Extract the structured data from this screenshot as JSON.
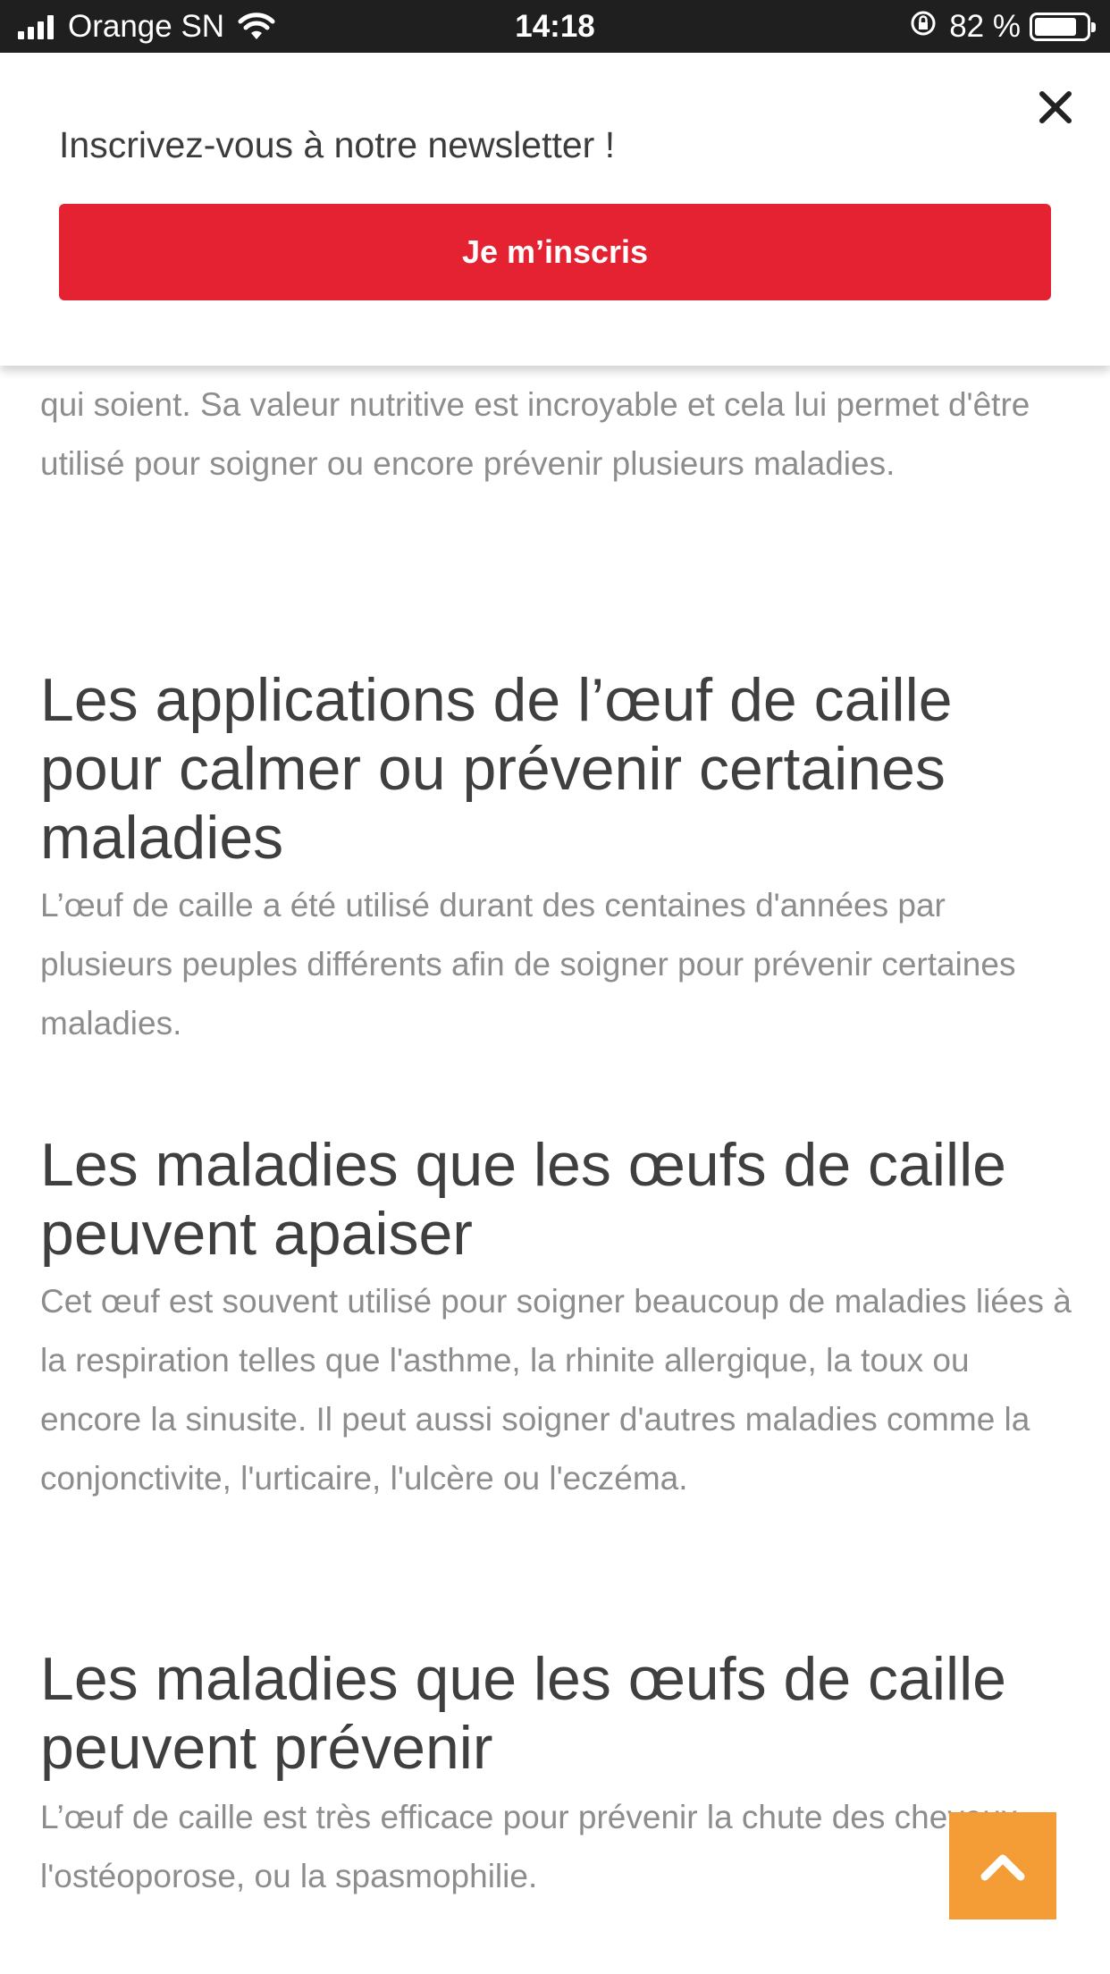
{
  "status_bar": {
    "carrier": "Orange SN",
    "time": "14:18",
    "battery_percent": "82 %",
    "battery_level": 0.82
  },
  "newsletter": {
    "text": "Inscrivez-vous à notre newsletter !",
    "button_label": "Je m’inscris",
    "button_color": "#e52231"
  },
  "article": {
    "intro_paragraph": "qui soient. Sa valeur nutritive est incroyable et cela lui permet d'être utilisé pour soigner ou encore prévenir plusieurs maladies.",
    "sections": [
      {
        "heading": "Les applications de l’œuf de caille pour calmer ou prévenir certaines maladies",
        "paragraph": "L’œuf de caille a été utilisé durant des centaines d'années par plusieurs peuples différents afin de soigner pour prévenir certaines maladies."
      },
      {
        "heading": "Les maladies que les œufs de caille peuvent apaiser",
        "paragraph": "Cet œuf est souvent utilisé pour soigner beaucoup de maladies liées à la respiration telles que l'asthme, la rhinite allergique, la toux ou encore la sinusite. Il peut aussi soigner d'autres maladies comme la conjonctivite, l'urticaire, l'ulcère ou l'eczéma."
      },
      {
        "heading": "Les maladies que les œufs de caille peuvent prévenir",
        "paragraph": "L’œuf de caille est très efficace pour prévenir la chute des cheveux, l'ostéoporose, ou la spasmophilie."
      }
    ]
  },
  "back_to_top": {
    "icon": "chevron-up-icon",
    "color": "#f49d37"
  }
}
